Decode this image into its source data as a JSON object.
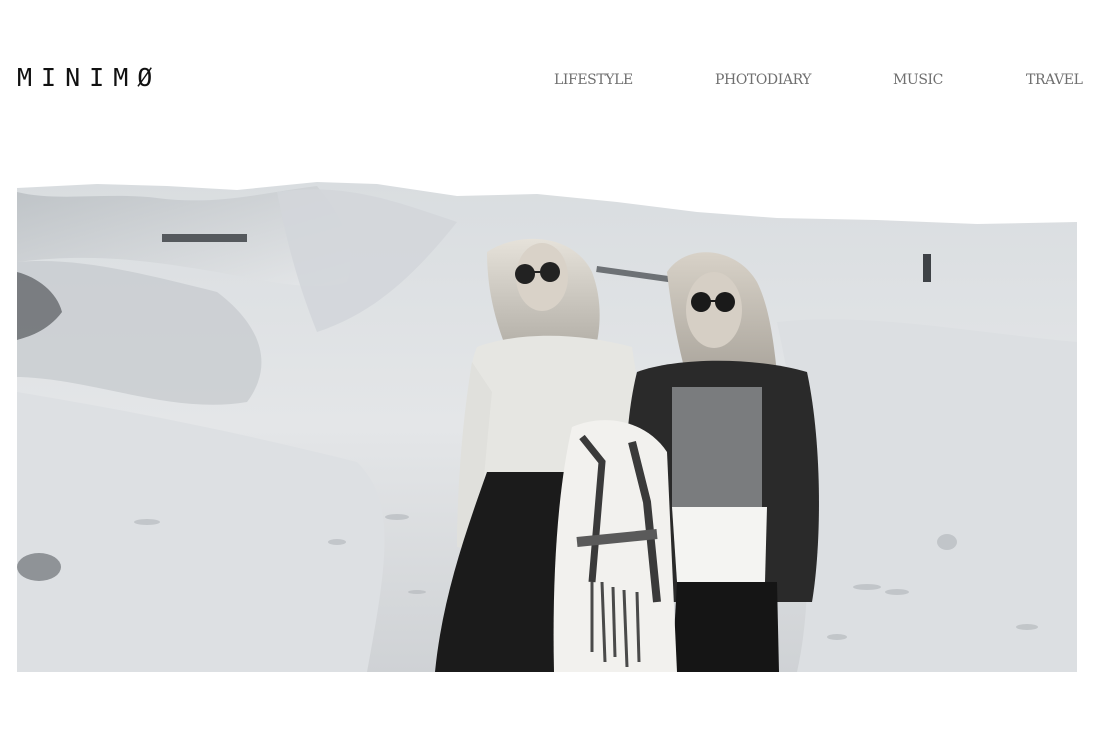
{
  "header": {
    "logo_text": "MINIMØ",
    "nav": [
      {
        "label": "LIFESTYLE"
      },
      {
        "label": "PHOTODIARY"
      },
      {
        "label": "MUSIC"
      },
      {
        "label": "TRAVEL"
      }
    ]
  },
  "hero": {
    "tone": "monochrome",
    "subjects": "two-women-on-white-sand-dunes"
  },
  "colors": {
    "background": "#ffffff",
    "logo": "#111111",
    "nav_text": "#6f6f6f"
  }
}
